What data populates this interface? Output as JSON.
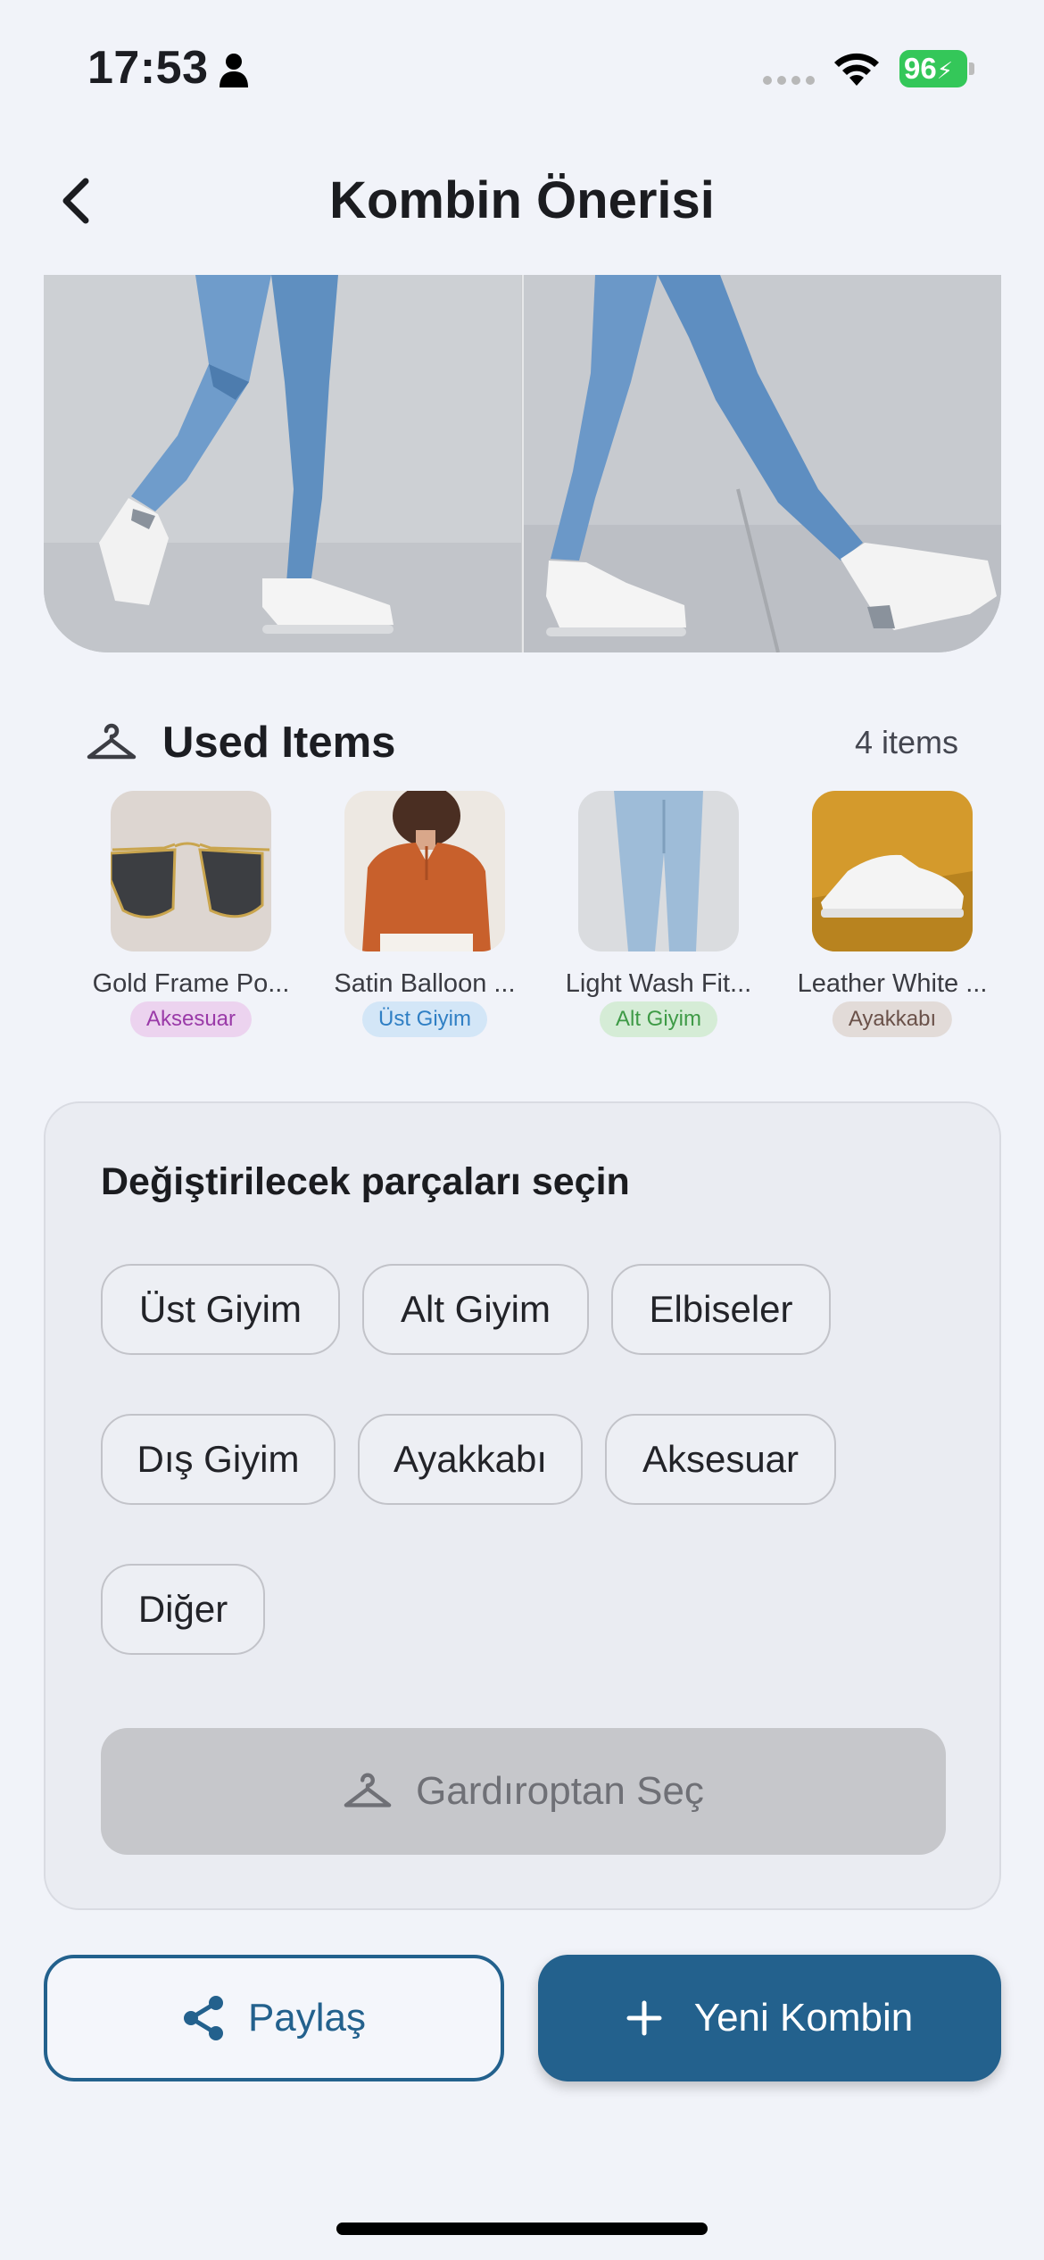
{
  "status_bar": {
    "time": "17:53",
    "battery": "96"
  },
  "header": {
    "title": "Kombin Önerisi"
  },
  "used_items": {
    "title": "Used Items",
    "count": "4 items",
    "items": [
      {
        "name": "Gold Frame Po...",
        "category": "Aksesuar",
        "badge_bg": "#ecd3ef",
        "badge_fg": "#9a3aa8"
      },
      {
        "name": "Satin Balloon ...",
        "category": "Üst Giyim",
        "badge_bg": "#d3e6f7",
        "badge_fg": "#2f7fc4"
      },
      {
        "name": "Light Wash Fit...",
        "category": "Alt Giyim",
        "badge_bg": "#d5ecd6",
        "badge_fg": "#3e9a46"
      },
      {
        "name": "Leather White ...",
        "category": "Ayakkabı",
        "badge_bg": "#e2dbd8",
        "badge_fg": "#6a5149"
      }
    ]
  },
  "replace_panel": {
    "title": "Değiştirilecek parçaları seçin",
    "chips": [
      "Üst Giyim",
      "Alt Giyim",
      "Elbiseler",
      "Dış Giyim",
      "Ayakkabı",
      "Aksesuar",
      "Diğer"
    ],
    "wardrobe_button": "Gardıroptan Seç"
  },
  "actions": {
    "share": "Paylaş",
    "new_outfit": "Yeni Kombin"
  },
  "colors": {
    "primary": "#23618d",
    "background": "#f1f3f9",
    "battery": "#34c759"
  }
}
